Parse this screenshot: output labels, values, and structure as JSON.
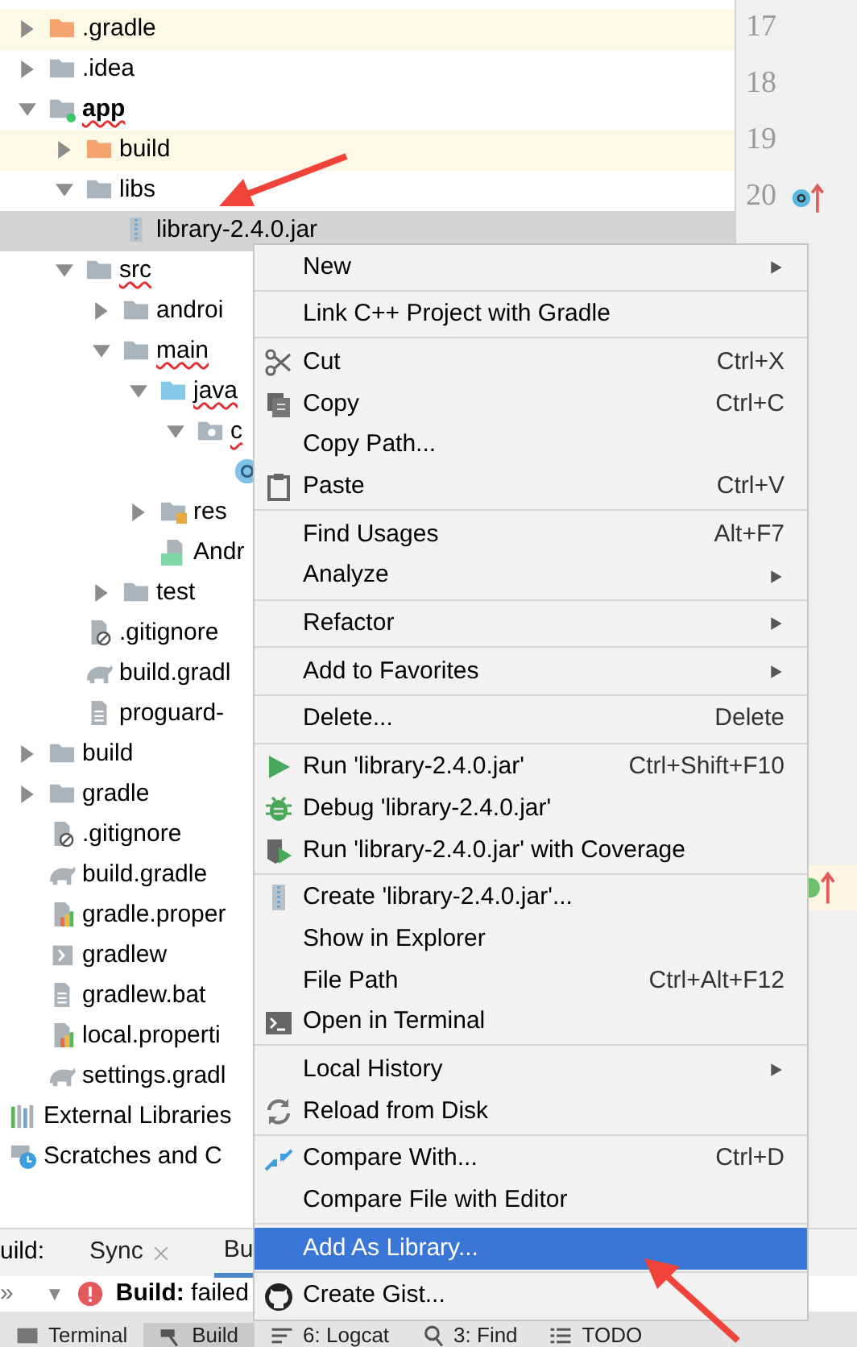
{
  "tree": [
    {
      "name": ".gradle",
      "kind": "folder-excluded",
      "expanded": false,
      "excluded": true,
      "selected": false,
      "misspelled": false
    },
    {
      "name": ".idea",
      "kind": "folder",
      "expanded": false,
      "excluded": false,
      "selected": false,
      "misspelled": false
    },
    {
      "name": "app",
      "kind": "folder-module",
      "expanded": true,
      "excluded": false,
      "selected": false,
      "misspelled": true,
      "bold": true,
      "children": [
        {
          "name": "build",
          "kind": "folder-excluded",
          "expanded": false,
          "excluded": true,
          "selected": false,
          "misspelled": false
        },
        {
          "name": "libs",
          "kind": "folder",
          "expanded": true,
          "excluded": false,
          "selected": false,
          "misspelled": false,
          "children": [
            {
              "name": "library-2.4.0.jar",
              "kind": "jar",
              "excluded": false,
              "selected": true,
              "misspelled": false
            }
          ]
        },
        {
          "name": "src",
          "kind": "folder",
          "expanded": true,
          "excluded": false,
          "selected": false,
          "misspelled": true,
          "children": [
            {
              "name": "androi",
              "kind": "folder",
              "expanded": false,
              "excluded": false,
              "selected": false,
              "misspelled": false
            },
            {
              "name": "main",
              "kind": "folder",
              "expanded": true,
              "excluded": false,
              "selected": false,
              "misspelled": true,
              "children": [
                {
                  "name": "java",
                  "kind": "folder-source",
                  "expanded": true,
                  "excluded": false,
                  "selected": false,
                  "misspelled": true,
                  "children": [
                    {
                      "name": "c",
                      "kind": "package",
                      "expanded": true,
                      "excluded": false,
                      "selected": false,
                      "misspelled": true,
                      "children": [
                        {
                          "kind": "class",
                          "excluded": false,
                          "selected": false
                        }
                      ]
                    }
                  ]
                },
                {
                  "name": "res",
                  "kind": "folder-res",
                  "expanded": false,
                  "excluded": false,
                  "selected": false,
                  "misspelled": false
                },
                {
                  "name": "Andr",
                  "kind": "manifest",
                  "excluded": false,
                  "selected": false,
                  "misspelled": false
                }
              ]
            },
            {
              "name": "test",
              "kind": "folder",
              "expanded": false,
              "excluded": false,
              "selected": false,
              "misspelled": false
            }
          ]
        },
        {
          "name": ".gitignore",
          "kind": "gitignore",
          "excluded": false,
          "selected": false,
          "misspelled": false
        },
        {
          "name": "build.gradl",
          "kind": "gradle",
          "excluded": false,
          "selected": false,
          "misspelled": false
        },
        {
          "name": "proguard-",
          "kind": "text-file",
          "excluded": false,
          "selected": false,
          "misspelled": false
        }
      ]
    },
    {
      "name": "build",
      "kind": "folder",
      "expanded": false,
      "excluded": false,
      "selected": false,
      "misspelled": false
    },
    {
      "name": "gradle",
      "kind": "folder",
      "expanded": false,
      "excluded": false,
      "selected": false,
      "misspelled": false
    },
    {
      "name": ".gitignore",
      "kind": "gitignore",
      "excluded": false,
      "selected": false,
      "misspelled": false
    },
    {
      "name": "build.gradle",
      "kind": "gradle",
      "excluded": false,
      "selected": false,
      "misspelled": false
    },
    {
      "name": "gradle.proper",
      "kind": "properties",
      "excluded": false,
      "selected": false,
      "misspelled": false
    },
    {
      "name": "gradlew",
      "kind": "shell",
      "excluded": false,
      "selected": false,
      "misspelled": false
    },
    {
      "name": "gradlew.bat",
      "kind": "text-file",
      "excluded": false,
      "selected": false,
      "misspelled": false
    },
    {
      "name": "local.properti",
      "kind": "properties",
      "excluded": false,
      "selected": false,
      "misspelled": false
    },
    {
      "name": "settings.gradl",
      "kind": "gradle",
      "excluded": false,
      "selected": false,
      "misspelled": false
    },
    {
      "name": "External Libraries",
      "kind": "libraries",
      "excluded": false,
      "selected": false,
      "misspelled": false
    },
    {
      "name": "Scratches and C",
      "kind": "scratches",
      "excluded": false,
      "selected": false,
      "misspelled": false
    }
  ],
  "gutter": {
    "lines": [
      {
        "number": "17",
        "kind": "plain",
        "highlighted": false
      },
      {
        "number": "18",
        "kind": "plain",
        "highlighted": false
      },
      {
        "number": "19",
        "kind": "plain",
        "highlighted": false
      },
      {
        "number": "20",
        "kind": "override",
        "highlighted": false
      }
    ],
    "lower_mark": {
      "kind": "implements",
      "highlighted": true
    }
  },
  "build_panel": {
    "label": "uild:",
    "tabs": [
      {
        "label": "Sync",
        "closable": true,
        "selected": false
      },
      {
        "label": "Bu",
        "closable": false,
        "selected": true
      }
    ],
    "expander": "»",
    "toggle": "▼",
    "message": "**Build:** failed"
  },
  "tool_strip": [
    {
      "label": "Terminal",
      "kind": "terminal",
      "selected": false
    },
    {
      "label": "Build",
      "kind": "hammer",
      "selected": true
    },
    {
      "label": "6: Logcat",
      "kind": "lines",
      "selected": false
    },
    {
      "label": "3: Find",
      "kind": "search",
      "selected": false
    },
    {
      "label": "TODO",
      "kind": "list",
      "selected": false
    }
  ],
  "context_menu": [
    {
      "kind": "item",
      "label": "New",
      "submenu": true,
      "selected": false
    },
    {
      "kind": "separator"
    },
    {
      "kind": "item",
      "label": "Link C++ Project with Gradle",
      "submenu": false,
      "selected": false
    },
    {
      "kind": "separator"
    },
    {
      "kind": "item",
      "label": "Cut",
      "shortcut": "Ctrl+X",
      "submenu": false,
      "selected": false
    },
    {
      "kind": "item",
      "label": "Copy",
      "shortcut": "Ctrl+C",
      "submenu": false,
      "selected": false
    },
    {
      "kind": "item",
      "label": "Copy Path...",
      "submenu": false,
      "selected": false
    },
    {
      "kind": "item",
      "label": "Paste",
      "shortcut": "Ctrl+V",
      "submenu": false,
      "selected": false
    },
    {
      "kind": "separator"
    },
    {
      "kind": "item",
      "label": "Find Usages",
      "shortcut": "Alt+F7",
      "submenu": false,
      "selected": false
    },
    {
      "kind": "item",
      "label": "Analyze",
      "submenu": true,
      "selected": false
    },
    {
      "kind": "separator"
    },
    {
      "kind": "item",
      "label": "Refactor",
      "submenu": true,
      "selected": false
    },
    {
      "kind": "separator"
    },
    {
      "kind": "item",
      "label": "Add to Favorites",
      "submenu": true,
      "selected": false
    },
    {
      "kind": "separator"
    },
    {
      "kind": "item",
      "label": "Delete...",
      "shortcut": "Delete",
      "submenu": false,
      "selected": false
    },
    {
      "kind": "separator"
    },
    {
      "kind": "item",
      "label": "Run 'library-2.4.0.jar'",
      "shortcut": "Ctrl+Shift+F10",
      "submenu": false,
      "selected": false
    },
    {
      "kind": "item",
      "label": "Debug 'library-2.4.0.jar'",
      "submenu": false,
      "selected": false
    },
    {
      "kind": "item",
      "label": "Run 'library-2.4.0.jar' with Coverage",
      "submenu": false,
      "selected": false
    },
    {
      "kind": "separator"
    },
    {
      "kind": "item",
      "label": "Create 'library-2.4.0.jar'...",
      "submenu": false,
      "selected": false
    },
    {
      "kind": "item",
      "label": "Show in Explorer",
      "submenu": false,
      "selected": false
    },
    {
      "kind": "item",
      "label": "File Path",
      "shortcut": "Ctrl+Alt+F12",
      "submenu": false,
      "selected": false
    },
    {
      "kind": "item",
      "label": "Open in Terminal",
      "submenu": false,
      "selected": false
    },
    {
      "kind": "separator"
    },
    {
      "kind": "item",
      "label": "Local History",
      "submenu": true,
      "selected": false
    },
    {
      "kind": "item",
      "label": "Reload from Disk",
      "submenu": false,
      "selected": false
    },
    {
      "kind": "separator"
    },
    {
      "kind": "item",
      "label": "Compare With...",
      "shortcut": "Ctrl+D",
      "submenu": false,
      "selected": false
    },
    {
      "kind": "item",
      "label": "Compare File with Editor",
      "submenu": false,
      "selected": false
    },
    {
      "kind": "separator"
    },
    {
      "kind": "item",
      "label": "Add As Library...",
      "submenu": false,
      "selected": true
    },
    {
      "kind": "separator"
    },
    {
      "kind": "item",
      "label": "Create Gist...",
      "submenu": false,
      "selected": false
    }
  ]
}
